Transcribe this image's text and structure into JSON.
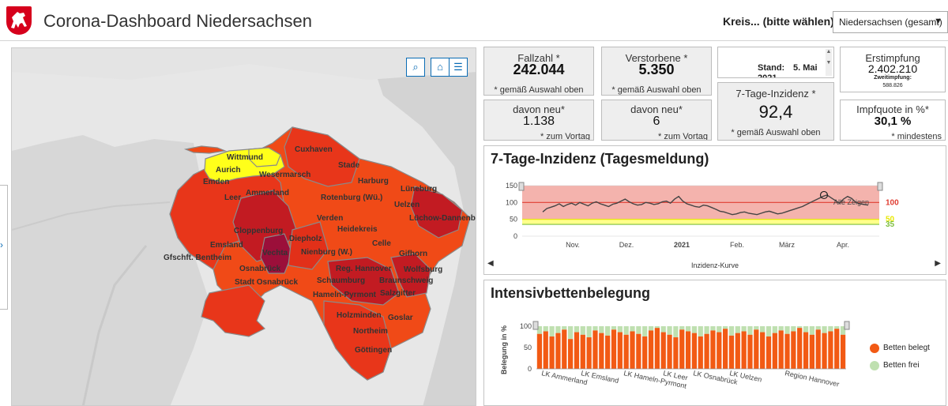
{
  "header": {
    "title": "Corona-Dashboard Niedersachsen",
    "kreis_label": "Kreis... (bitte wählen):",
    "kreis_value": "Niedersachsen (gesamt)"
  },
  "map": {
    "labels": [
      "Wittmund",
      "Aurich",
      "Emden",
      "Wesermarsch",
      "Cuxhaven",
      "Stade",
      "Leer",
      "Ammerland",
      "Harburg",
      "Lüneburg",
      "Rotenburg (Wü.)",
      "Uelzen",
      "Lüchow-Dannenberg",
      "Verden",
      "Heidekreis",
      "Cloppenburg",
      "Diepholz",
      "Vechta",
      "Emsland",
      "Nienburg (W.)",
      "Celle",
      "Gifhorn",
      "Gfschft. Bentheim",
      "Osnabrück",
      "Reg. Hannover",
      "Wolfsburg",
      "Stadt Osnabrück",
      "Schaumburg",
      "Braunschweig",
      "Hameln-Pyrmont",
      "Salzgitter",
      "Holzminden",
      "Goslar",
      "Northeim",
      "Göttingen"
    ],
    "colors": {
      "high": "#e8361a",
      "mid": "#f04a17",
      "dark": "#c21b22",
      "darker": "#9b0f3a",
      "yellow": "#ffff1a",
      "water": "#e7e7e7",
      "land": "#d8d8d8"
    }
  },
  "stats": {
    "fallzahl_label": "Fallzahl *",
    "fallzahl_value": "242.044",
    "fallzahl_note": "* gemäß Auswahl oben",
    "verstorbene_label": "Verstorbene *",
    "verstorbene_value": "5.350",
    "verstorbene_note": "* gemäß Auswahl oben",
    "stand_label": "Stand:",
    "stand_value": "5. Mai",
    "stand_year": "2021",
    "erstimpfung_label": "Erstimpfung",
    "erstimpfung_value": "2.402.210",
    "zweitimpfung_label": "Zweitimpfung:",
    "zweitimpfung_value": "588.826",
    "neu_faelle_label": "davon neu*",
    "neu_faelle_value": "1.138",
    "neu_faelle_note": "* zum Vortag",
    "neu_tote_label": "davon neu*",
    "neu_tote_value": "6",
    "neu_tote_note": "* zum Vortag",
    "inzidenz_label": "7-Tage-Inzidenz *",
    "inzidenz_value": "92,4",
    "inzidenz_note": "* gemäß Auswahl oben",
    "impfquote_label": "Impfquote in %*",
    "impfquote_value": "30,1 %",
    "impfquote_note": "* mindestens"
  },
  "inzidenz_chart": {
    "title": "7-Tage-Inzidenz (Tagesmeldung)",
    "show_all": "Alle Zeigen",
    "footer": "Inzidenz-Kurve",
    "threshold_labels": [
      "100",
      "50",
      "35"
    ],
    "threshold_colors": [
      "#e03c31",
      "#e8e800",
      "#7fbf3f"
    ]
  },
  "icu_chart": {
    "title": "Intensivbettenbelegung",
    "legend_belegt": "Betten belegt",
    "legend_frei": "Betten frei",
    "color_belegt": "#f25a14",
    "color_frei": "#bfe0b0"
  },
  "chart_data": [
    {
      "type": "line",
      "title": "7-Tage-Inzidenz (Tagesmeldung)",
      "xlabel": "",
      "ylabel": "",
      "x_ticks": [
        "Nov.",
        "Dez.",
        "2021",
        "Feb.",
        "März",
        "Apr."
      ],
      "y_ticks": [
        0,
        50,
        100,
        150
      ],
      "ylim": [
        0,
        150
      ],
      "series": [
        {
          "values": [
            72,
            82,
            86,
            90,
            96,
            88,
            94,
            98,
            92,
            100,
            95,
            90,
            98,
            102,
            96,
            92,
            88,
            95,
            98,
            104,
            110,
            102,
            96,
            92,
            94,
            100,
            98,
            94,
            96,
            102,
            104,
            98,
            110,
            118,
            104,
            96,
            92,
            88,
            86,
            92,
            90,
            85,
            80,
            74,
            72,
            68,
            64,
            66,
            70,
            72,
            68,
            66,
            64,
            68,
            72,
            74,
            70,
            66,
            68,
            72,
            76,
            80,
            84,
            88,
            94,
            100,
            106,
            112,
            118,
            122,
            114,
            106,
            98,
            110,
            118,
            112,
            100,
            96,
            94,
            92
          ]
        }
      ],
      "thresholds": [
        100,
        50,
        35
      ]
    },
    {
      "type": "bar",
      "title": "Intensivbettenbelegung",
      "ylabel": "Belegung in %",
      "ylim": [
        0,
        100
      ],
      "y_ticks": [
        0,
        50,
        100
      ],
      "categories": [
        "LK Ammerland",
        "LK Emsland",
        "LK Hameln-Pyrmont",
        "LK Leer",
        "LK Osnabrück",
        "LK Uelzen",
        "Region Hannover"
      ],
      "series": [
        {
          "name": "Betten belegt",
          "values": [
            82,
            88,
            76,
            84,
            92,
            70,
            86,
            80,
            74,
            90,
            84,
            78,
            92,
            86,
            80,
            88,
            82,
            76,
            90,
            96,
            86,
            80,
            74,
            92,
            88,
            84,
            76,
            82,
            90,
            86,
            94,
            78,
            84,
            88,
            80,
            92,
            86,
            76,
            84,
            90,
            82,
            88,
            96,
            86,
            80,
            92,
            84,
            88,
            94,
            80
          ]
        },
        {
          "name": "Betten frei",
          "values": [
            18,
            12,
            24,
            16,
            8,
            30,
            14,
            20,
            26,
            10,
            16,
            22,
            8,
            14,
            20,
            12,
            18,
            24,
            10,
            4,
            14,
            20,
            26,
            8,
            12,
            16,
            24,
            18,
            10,
            14,
            6,
            22,
            16,
            12,
            20,
            8,
            14,
            24,
            16,
            10,
            18,
            12,
            4,
            14,
            20,
            8,
            16,
            12,
            6,
            20
          ]
        }
      ]
    }
  ]
}
